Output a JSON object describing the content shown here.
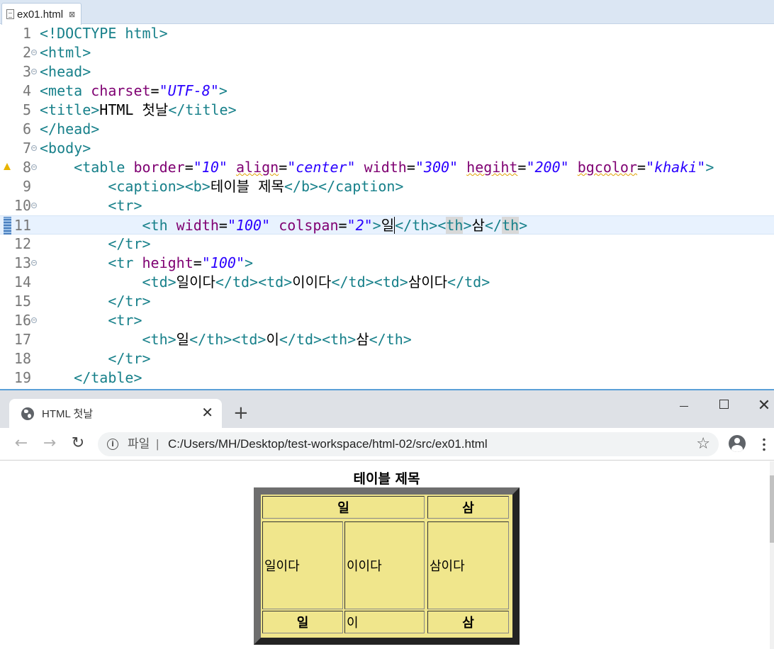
{
  "editor": {
    "tab_label": "ex01.html",
    "tab_close": "⊠",
    "line_numbers": [
      "1",
      "2",
      "3",
      "4",
      "5",
      "6",
      "7",
      "8",
      "9",
      "10",
      "11",
      "12",
      "13",
      "14",
      "15",
      "16",
      "17",
      "18",
      "19"
    ]
  },
  "browser": {
    "tab_title": "HTML 첫날",
    "tab_close": "✕",
    "new_tab": "+",
    "window_close": "✕",
    "back": "←",
    "forward": "→",
    "reload": "↻",
    "info": "i",
    "scheme_label": "파일",
    "url_separator": "|",
    "url": "C:/Users/MH/Desktop/test-workspace/html-02/src/ex01.html",
    "star": "☆"
  },
  "demo_table": {
    "caption": "테이블 제목",
    "row1": [
      "일",
      "삼"
    ],
    "row2": [
      "일이다",
      "이이다",
      "삼이다"
    ],
    "row3": [
      "일",
      "이",
      "삼"
    ],
    "bgcolor": "#f0e68c"
  }
}
